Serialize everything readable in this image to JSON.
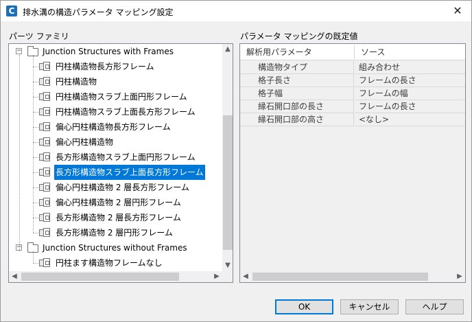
{
  "window": {
    "title": "排水溝の構造パラメータ マッピング設定",
    "app_icon_letter": "C"
  },
  "left_panel": {
    "label": "パーツ ファミリ",
    "tree": [
      {
        "label": "Junction Structures with Frames",
        "expanded": true,
        "children": [
          "円柱構造物長方形フレーム",
          "円柱構造物",
          "円柱構造物スラブ上面円形フレーム",
          "円柱構造物スラブ上面長方形フレーム",
          "偏心円柱構造物長方形フレーム",
          "偏心円柱構造物",
          "長方形構造物スラブ上面円形フレーム",
          "長方形構造物スラブ上面長方形フレーム",
          "偏心円柱構造物 2 層長方形フレーム",
          "偏心円柱構造物 2 層円形フレーム",
          "長方形構造物 2 層長方形フレーム",
          "長方形構造物 2 層円形フレーム"
        ]
      },
      {
        "label": "Junction Structures without Frames",
        "expanded": true,
        "children": [
          "円柱ます構造物フレームなし"
        ]
      }
    ],
    "selected_item": "長方形構造物スラブ上面長方形フレーム"
  },
  "right_panel": {
    "label": "パラメータ マッピングの既定値",
    "columns": [
      "解析用パラメータ",
      "ソース"
    ],
    "rows": [
      [
        "構造物タイプ",
        "組み合わせ"
      ],
      [
        "格子長さ",
        "フレームの長さ"
      ],
      [
        "格子幅",
        "フレームの幅"
      ],
      [
        "縁石開口部の長さ",
        "フレームの長さ"
      ],
      [
        "縁石開口部の高さ",
        "<なし>"
      ]
    ]
  },
  "buttons": {
    "ok": "OK",
    "cancel": "キャンセル",
    "help": "ヘルプ"
  },
  "colors": {
    "selection": "#0078d7",
    "default_button_border": "#0078d7"
  }
}
